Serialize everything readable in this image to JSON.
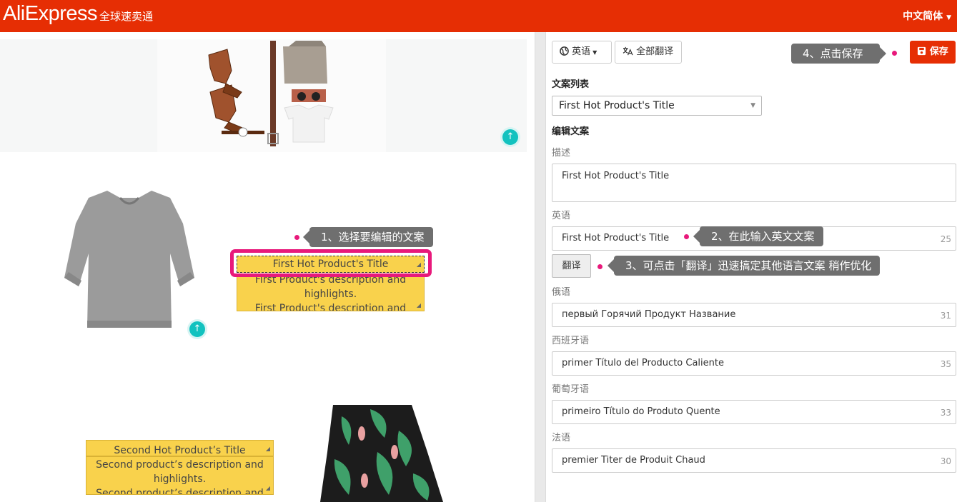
{
  "header": {
    "logo_main": "AliExpress",
    "logo_sub": "全球速卖通",
    "language": "中文简体"
  },
  "canvas": {
    "product1": {
      "title": "First Hot Product's Title",
      "desc_line1": "First Product's description and",
      "desc_line2": "highlights.",
      "desc_line3": "First Product's description and"
    },
    "product2": {
      "title": "Second Hot Product’s Title",
      "desc_line1": "Second product’s description and",
      "desc_line2": "highlights.",
      "desc_line3": "Second product’s description and"
    },
    "up_icon": "↑"
  },
  "tips": {
    "step1": "1、选择要编辑的文案",
    "step2": "2、在此输入英文文案",
    "step3": "3、可点击「翻译」迅速搞定其他语言文案 稍作优化",
    "step4": "4、点击保存"
  },
  "panel": {
    "lang_button": "英语",
    "translate_all_button": "全部翻译",
    "save_button": "保存",
    "copy_list_label": "文案列表",
    "copy_list_selected": "First Hot Product's Title",
    "edit_label": "编辑文案",
    "desc_label": "描述",
    "desc_value": "First Hot Product's Title",
    "english_label": "英语",
    "english_value": "First Hot Product's Title",
    "english_count": "25",
    "translate_button": "翻译",
    "russian_label": "俄语",
    "russian_value": "первый Горячий Продукт Название",
    "russian_count": "31",
    "spanish_label": "西班牙语",
    "spanish_value": "primer Título del Producto Caliente",
    "spanish_count": "35",
    "portuguese_label": "葡萄牙语",
    "portuguese_value": "primeiro Título do Produto Quente",
    "portuguese_count": "33",
    "french_label": "法语",
    "french_value": "premier Titer de Produit Chaud",
    "french_count": "30"
  },
  "colors": {
    "brand": "#e62e04",
    "highlight": "#e8197b",
    "textbox": "#f9d24c",
    "teal": "#12c2bf"
  }
}
